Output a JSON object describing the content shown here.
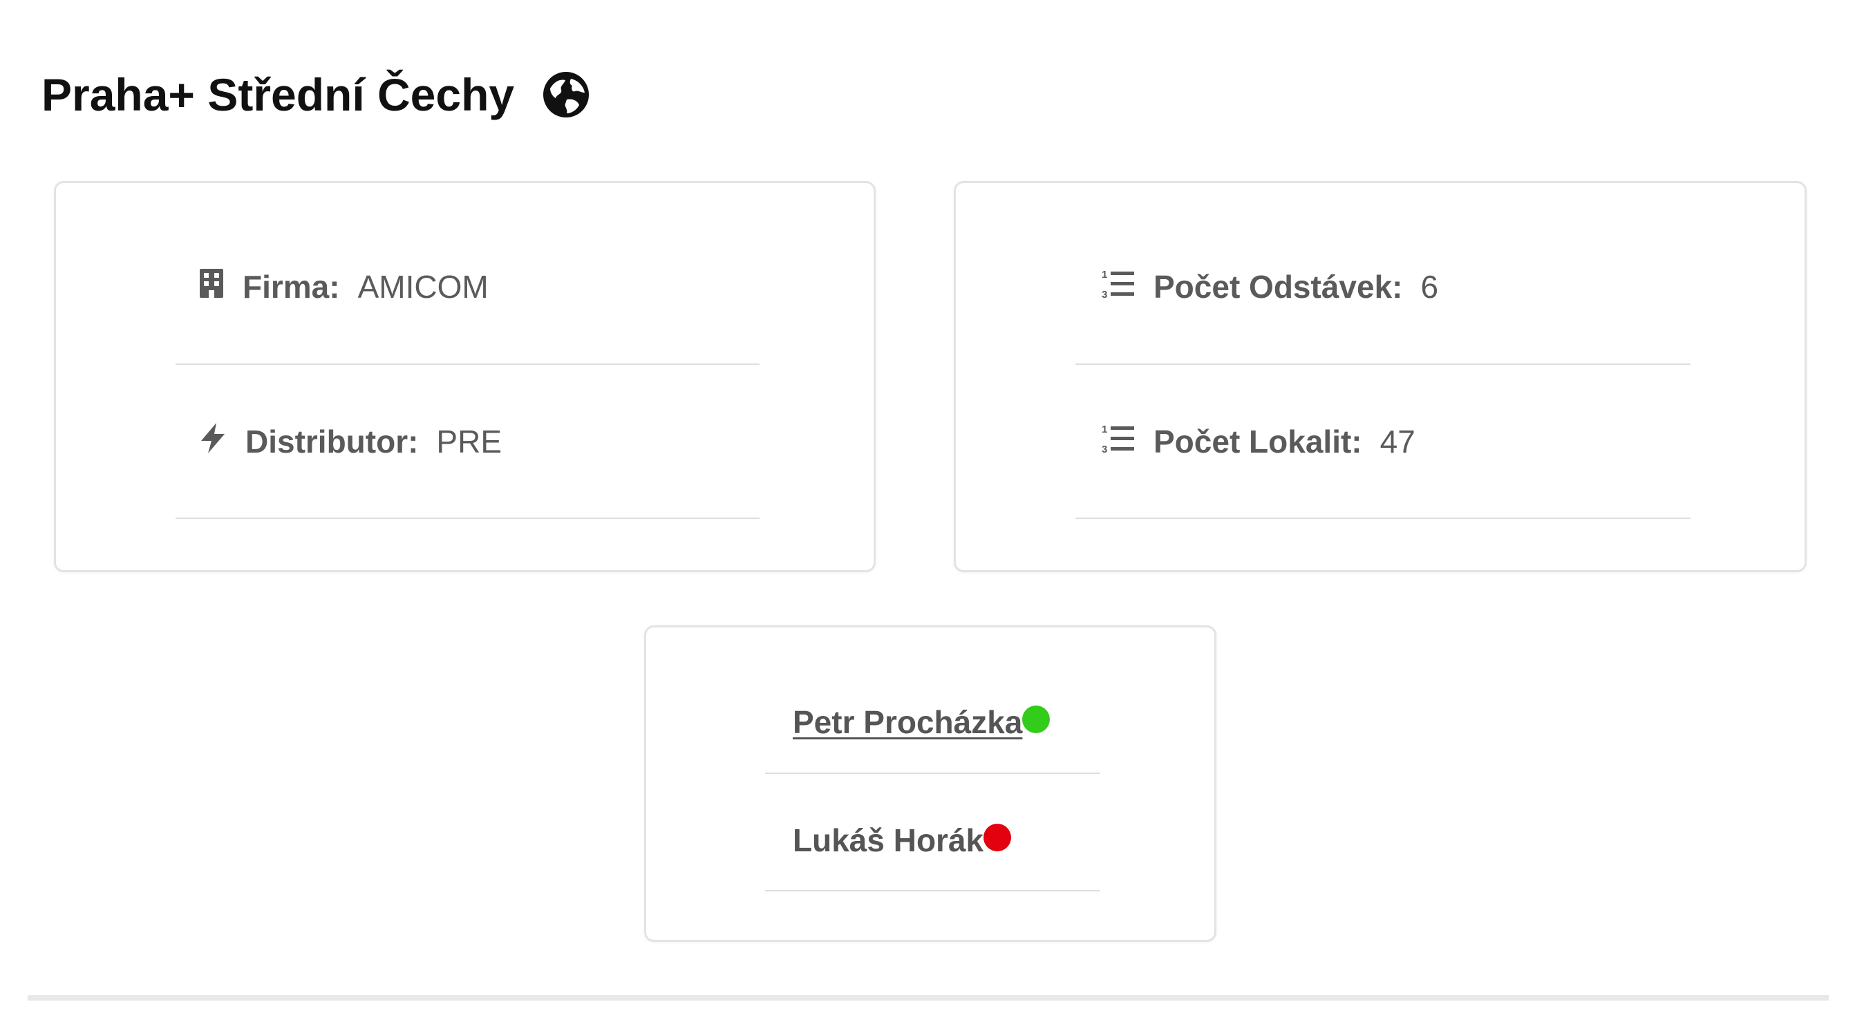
{
  "header": {
    "title": "Praha+ Střední Čechy",
    "icon": "globe-icon"
  },
  "company_card": {
    "firma": {
      "icon": "building-icon",
      "label": "Firma:",
      "value": "AMICOM"
    },
    "distributor": {
      "icon": "bolt-icon",
      "label": "Distributor:",
      "value": "PRE"
    }
  },
  "stats_card": {
    "odstavky": {
      "icon": "ordered-list-icon",
      "label": "Počet Odstávek:",
      "value": "6"
    },
    "lokality": {
      "icon": "ordered-list-icon",
      "label": "Počet Lokalit:",
      "value": "47"
    }
  },
  "people_card": {
    "people": [
      {
        "name": "Petr Procházka",
        "status": "online",
        "status_color": "#33cc1a"
      },
      {
        "name": "Lukáš Horák",
        "status": "offline",
        "status_color": "#e3000f"
      }
    ]
  },
  "colors": {
    "text_dark": "#111111",
    "text_muted": "#595959",
    "border": "#e3e3e3"
  }
}
